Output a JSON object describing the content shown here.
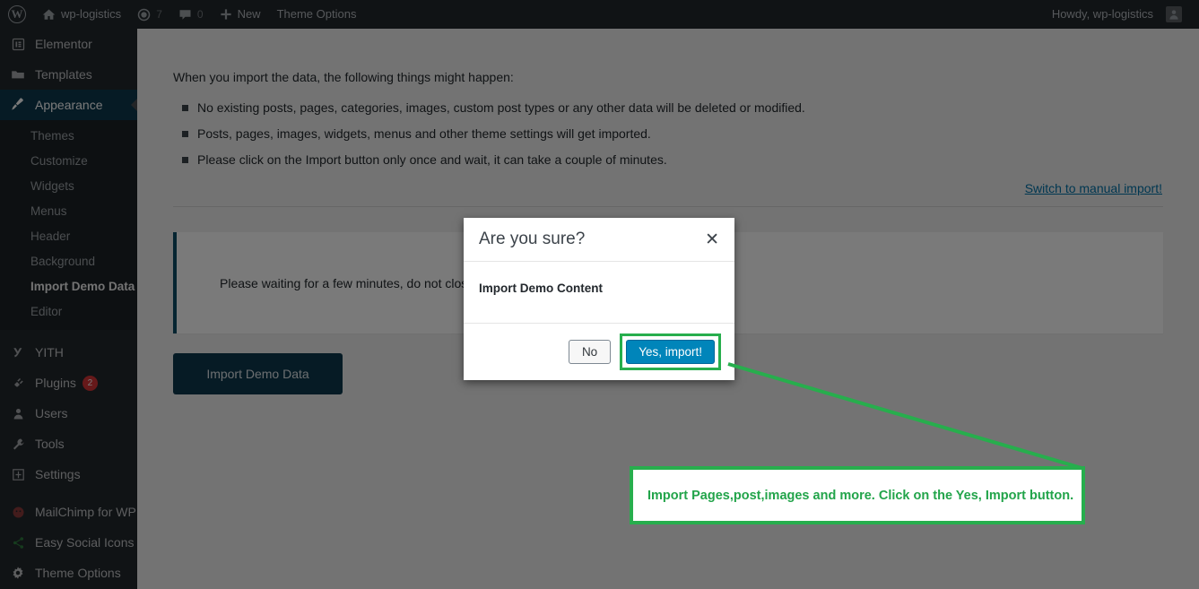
{
  "adminbar": {
    "wp_logo_icon": "wordpress-logo-icon",
    "site_icon": "home-icon",
    "site_name": "wp-logistics",
    "updates_icon": "updates-icon",
    "updates_count": "7",
    "comments_icon": "comment-icon",
    "comments_count": "0",
    "new_icon": "plus-icon",
    "new_label": "New",
    "theme_options_label": "Theme Options",
    "howdy": "Howdy, wp-logistics",
    "avatar_icon": "avatar-icon"
  },
  "sidebar": {
    "items": [
      {
        "label": "Elementor",
        "icon": "elementor-icon",
        "current": false
      },
      {
        "label": "Templates",
        "icon": "folder-icon",
        "current": false
      },
      {
        "label": "Appearance",
        "icon": "brush-icon",
        "current": true
      }
    ],
    "appearance_submenu": [
      {
        "label": "Themes",
        "current": false
      },
      {
        "label": "Customize",
        "current": false
      },
      {
        "label": "Widgets",
        "current": false
      },
      {
        "label": "Menus",
        "current": false
      },
      {
        "label": "Header",
        "current": false
      },
      {
        "label": "Background",
        "current": false
      },
      {
        "label": "Import Demo Data",
        "current": true
      },
      {
        "label": "Editor",
        "current": false
      }
    ],
    "items_lower": [
      {
        "label": "YITH",
        "icon": "yith-icon",
        "badge": ""
      },
      {
        "label": "Plugins",
        "icon": "plug-icon",
        "badge": "2"
      },
      {
        "label": "Users",
        "icon": "user-icon",
        "badge": ""
      },
      {
        "label": "Tools",
        "icon": "wrench-icon",
        "badge": ""
      },
      {
        "label": "Settings",
        "icon": "settings-icon",
        "badge": ""
      }
    ],
    "items_plugins": [
      {
        "label": "MailChimp for WP",
        "icon": "mailchimp-icon"
      },
      {
        "label": "Easy Social Icons",
        "icon": "share-icon"
      },
      {
        "label": "Theme Options",
        "icon": "gear-icon"
      }
    ]
  },
  "main": {
    "intro": "When you import the data, the following things might happen:",
    "bullets": [
      "No existing posts, pages, categories, images, custom post types or any other data will be deleted or modified.",
      "Posts, pages, images, widgets, menus and other theme settings will get imported.",
      "Please click on the Import button only once and wait, it can take a couple of minutes."
    ],
    "manual_link": "Switch to manual import!",
    "notice_text": "Please waiting for a few minutes, do not close this window until the data is imported.",
    "import_button": "Import Demo Data"
  },
  "modal": {
    "title": "Are you sure?",
    "close_icon": "close-icon",
    "body": "Import Demo Content",
    "no_label": "No",
    "yes_label": "Yes, import!"
  },
  "annotation": {
    "text": "Import Pages,post,images and more. Click on the  Yes, Import button.",
    "color": "#22a44a"
  },
  "colors": {
    "admin_dark": "#23282d",
    "sidebar_sub": "#1d2327",
    "current_menu": "#0e3a4f",
    "link_blue": "#0073aa",
    "primary_button": "#0085ba",
    "annotation_green": "#27ae4d",
    "badge_red": "#d63638",
    "notice_border": "#0e4f66"
  }
}
